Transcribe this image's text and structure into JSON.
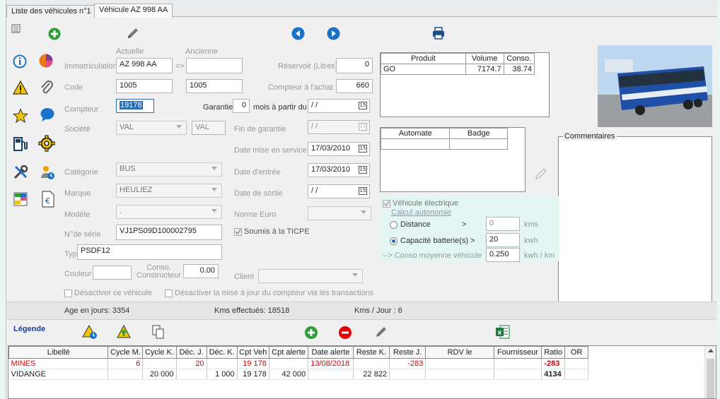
{
  "tabs": [
    "Liste des véhicules n°1",
    "Véhicule AZ 998 AA"
  ],
  "form": {
    "col_actuelle": "Actuelle",
    "col_ancienne": "Ancienne",
    "immat_label": "Immatriculation",
    "immat_value": "AZ 998 AA",
    "immat_arrow": "=>",
    "immat_old": "",
    "code_label": "Code",
    "code_value": "1005",
    "code_old": "1005",
    "compteur_label": "Compteur",
    "compteur_value": "19178",
    "garantie_label": "Garantie",
    "garantie_value": "0",
    "garantie_suffix": "mois à partir du",
    "garantie_date": " / /",
    "societe_label": "Société",
    "societe_value": "VAL",
    "societe_code": "VAL",
    "categorie_label": "Catégorie",
    "categorie_value": "BUS",
    "marque_label": "Marque",
    "marque_value": "HEULIEZ",
    "modele_label": "Modèle",
    "modele_value": ".",
    "serie_label": "N°de série",
    "serie_value": "VJ1PS09D100002795",
    "type_label": "Type",
    "type_value": "PSDF12",
    "couleur_label": "Couleur",
    "couleur_value": "",
    "conso_label": "Conso. Constructeur",
    "conso_label_1": "Conso.",
    "conso_label_2": "Constructeur",
    "conso_value": "0.00",
    "reservoir_label": "Réservoir (Litres)",
    "reservoir_value": "0",
    "compteur_achat_label": "Compteur à l'achat",
    "compteur_achat_value": "660",
    "fin_garantie_label": "Fin de garantie",
    "fin_garantie_value": " / /",
    "mise_service_label": "Date mise en service",
    "mise_service_value": "17/03/2010",
    "date_entree_label": "Date d'entrée",
    "date_entree_value": "17/03/2010",
    "date_sortie_label": "Date de sortie",
    "date_sortie_value": " / /",
    "norme_label": "Norme Euro",
    "norme_value": "",
    "ticpe_label": "Soumis à la TICPE",
    "client_label": "Client",
    "client_value": "",
    "desactiver_label": "Désactiver ce véhicule",
    "desactiver_maj_label": "Désactiver la mise à jour du compteur via les transactions"
  },
  "products": {
    "headers": [
      "Produit",
      "Volume",
      "Conso."
    ],
    "rows": [
      [
        "GO",
        "7174.7",
        "38.74"
      ]
    ]
  },
  "automates": {
    "headers": [
      "Automate",
      "Badge"
    ]
  },
  "commentaires_label": "Commentaires",
  "electric": {
    "title": "Véhicule électrique",
    "calc_label": "Calcul autonomie",
    "distance_label": "Distance",
    "distance_op": ">",
    "distance_value": "0",
    "distance_unit": "kms",
    "capacite_label": "Capacité batterie(s) >",
    "capacite_value": "20",
    "capacite_unit": "kwh",
    "conso_label": "--> Conso moyenne véhicule",
    "conso_value": "0.250",
    "conso_unit": "kwh / km"
  },
  "stats": {
    "age": "Age en jours: 3354",
    "kms": "Kms effectués: 18518",
    "kms_jour": "Kms / Jour : 6"
  },
  "legend_label": "Légende",
  "grid": {
    "headers": [
      "Libellé",
      "Cycle M.",
      "Cycle K.",
      "Déc. J.",
      "Déc. K.",
      "Cpt Veh",
      "Cpt alerte",
      "Date alerte",
      "Reste K.",
      "Reste J.",
      "RDV le",
      "Fournisseur",
      "Ratio",
      "OR"
    ],
    "rows": [
      [
        "MINES",
        "6",
        "",
        "20",
        "",
        "19 178",
        "",
        "13/08/2018",
        "",
        "-283",
        "",
        "",
        "-283",
        ""
      ],
      [
        "VIDANGE",
        "",
        "20 000",
        "",
        "1 000",
        "19 178",
        "42 000",
        "",
        "22 822",
        "",
        "",
        "",
        "4134",
        ""
      ]
    ]
  },
  "colors": {
    "accent_blue": "#1a73c9",
    "green": "#2e9e3a",
    "red": "#e00000",
    "electric_bg": "#e3f6f4"
  }
}
